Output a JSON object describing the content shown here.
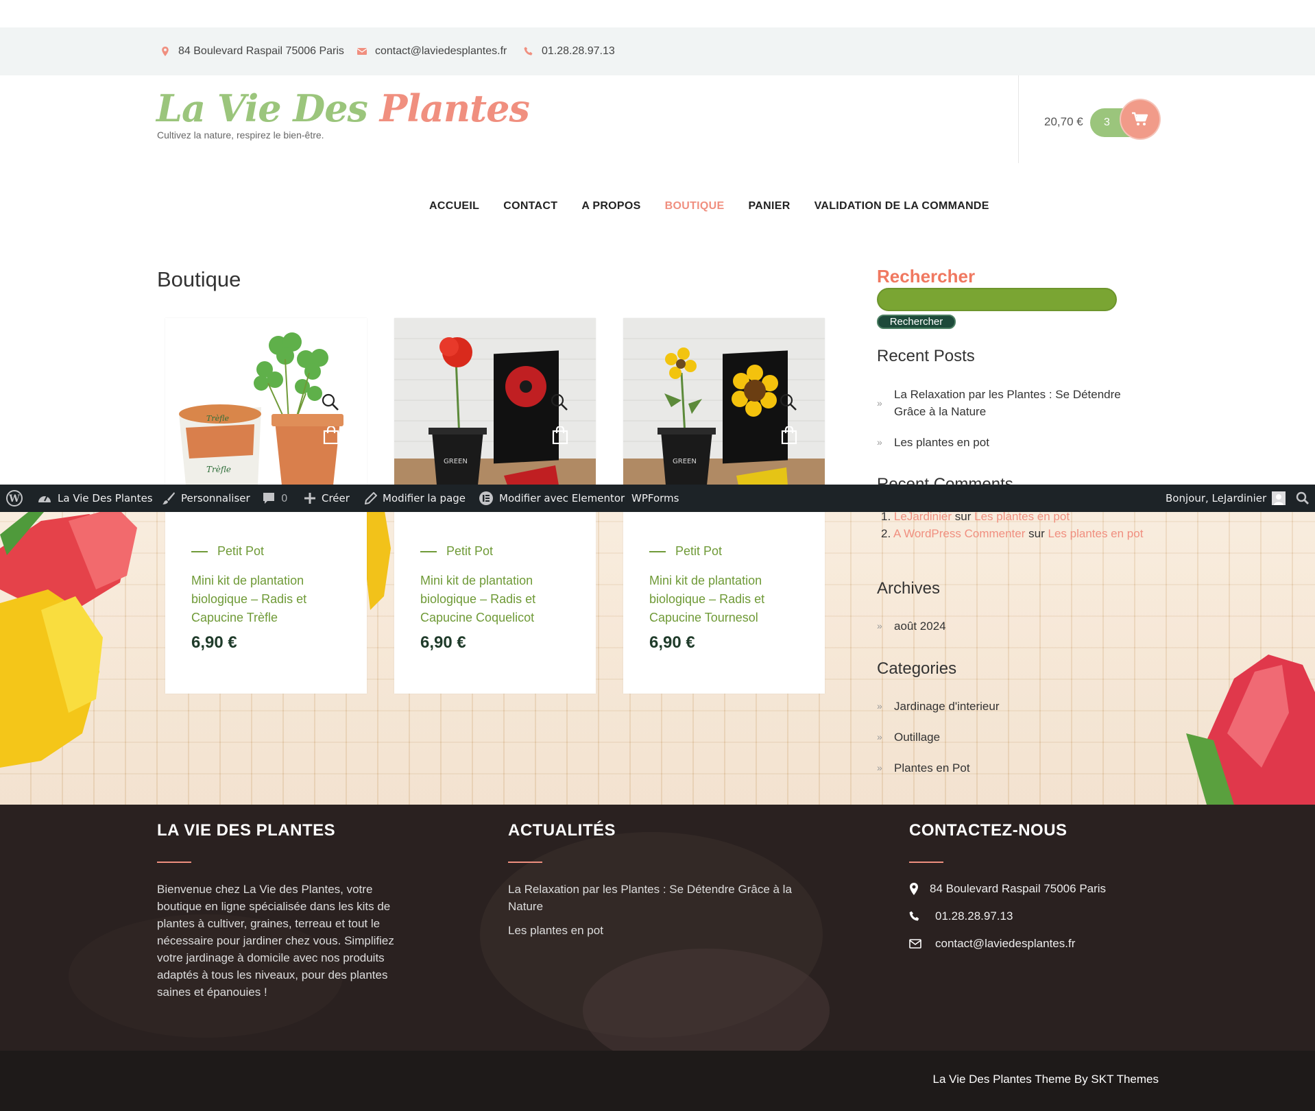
{
  "topbar": {
    "address": "84 Boulevard Raspail 75006 Paris",
    "email": "contact@laviedesplantes.fr",
    "phone": "01.28.28.97.13"
  },
  "header": {
    "logo_part1": "La Vie Des",
    "logo_part2": "Plantes",
    "tagline": "Cultivez la nature, respirez le bien-être.",
    "cart_total": "20,70 €",
    "cart_count": "3"
  },
  "menu": [
    "ACCUEIL",
    "CONTACT",
    "A PROPOS",
    "BOUTIQUE",
    "PANIER",
    "VALIDATION DE LA COMMANDE"
  ],
  "menu_active": "BOUTIQUE",
  "page_title": "Boutique",
  "products": [
    {
      "category": "Petit Pot",
      "name": "Mini kit de plantation biologique – Radis et Capucine Trèfle",
      "price": "6,90 €",
      "image": "clover-pot"
    },
    {
      "category": "Petit Pot",
      "name": "Mini kit de plantation biologique – Radis et Capucine Coquelicot",
      "price": "6,90 €",
      "image": "poppy-pot"
    },
    {
      "category": "Petit Pot",
      "name": "Mini kit de plantation biologique – Radis et Capucine Tournesol",
      "price": "6,90 €",
      "image": "sunflower-pot"
    }
  ],
  "sidebar": {
    "search_title": "Rechercher",
    "search_button": "Rechercher",
    "recent_posts_title": "Recent Posts",
    "recent_posts": [
      "La Relaxation par les Plantes : Se Détendre Grâce à la Nature",
      "Les plantes en pot"
    ],
    "recent_comments_title": "Recent Comments",
    "comments": [
      {
        "num": "1.",
        "author": "LeJardinier",
        "sep": "sur",
        "post": "Les plantes en pot"
      },
      {
        "num": "2.",
        "author": "A WordPress Commenter",
        "sep": "sur",
        "post": "Les plantes en pot"
      }
    ],
    "archives_title": "Archives",
    "archives": [
      "août 2024"
    ],
    "categories_title": "Categories",
    "categories": [
      "Jardinage d'interieur",
      "Outillage",
      "Plantes en Pot"
    ]
  },
  "adminbar": {
    "site": "La Vie Des Plantes",
    "customize": "Personnaliser",
    "comments_count": "0",
    "new": "Créer",
    "edit": "Modifier la page",
    "elementor": "Modifier avec Elementor",
    "wpforms": "WPForms",
    "greeting": "Bonjour, LeJardinier"
  },
  "footer": {
    "col1_title": "LA VIE DES PLANTES",
    "col1_text": "Bienvenue chez La Vie des Plantes, votre boutique en ligne spécialisée dans les kits de plantes à cultiver, graines, terreau et tout le nécessaire pour jardiner chez vous. Simplifiez votre jardinage à domicile avec nos produits adaptés à tous les niveaux, pour des plantes saines et épanouies !",
    "col2_title": "ACTUALITÉS",
    "col2_links": [
      "La Relaxation par les Plantes : Se Détendre Grâce à la Nature",
      "Les plantes en pot"
    ],
    "col3_title": "CONTACTEZ-NOUS",
    "address": "84 Boulevard Raspail 75006 Paris",
    "phone": "01.28.28.97.13",
    "email": "contact@laviedesplantes.fr",
    "credit": "La Vie Des Plantes Theme By SKT Themes"
  },
  "colors": {
    "brand_green": "#9bc57c",
    "brand_pink": "#f08f7f",
    "product_green": "#6f9a37",
    "footer_bg": "#2a2120"
  }
}
